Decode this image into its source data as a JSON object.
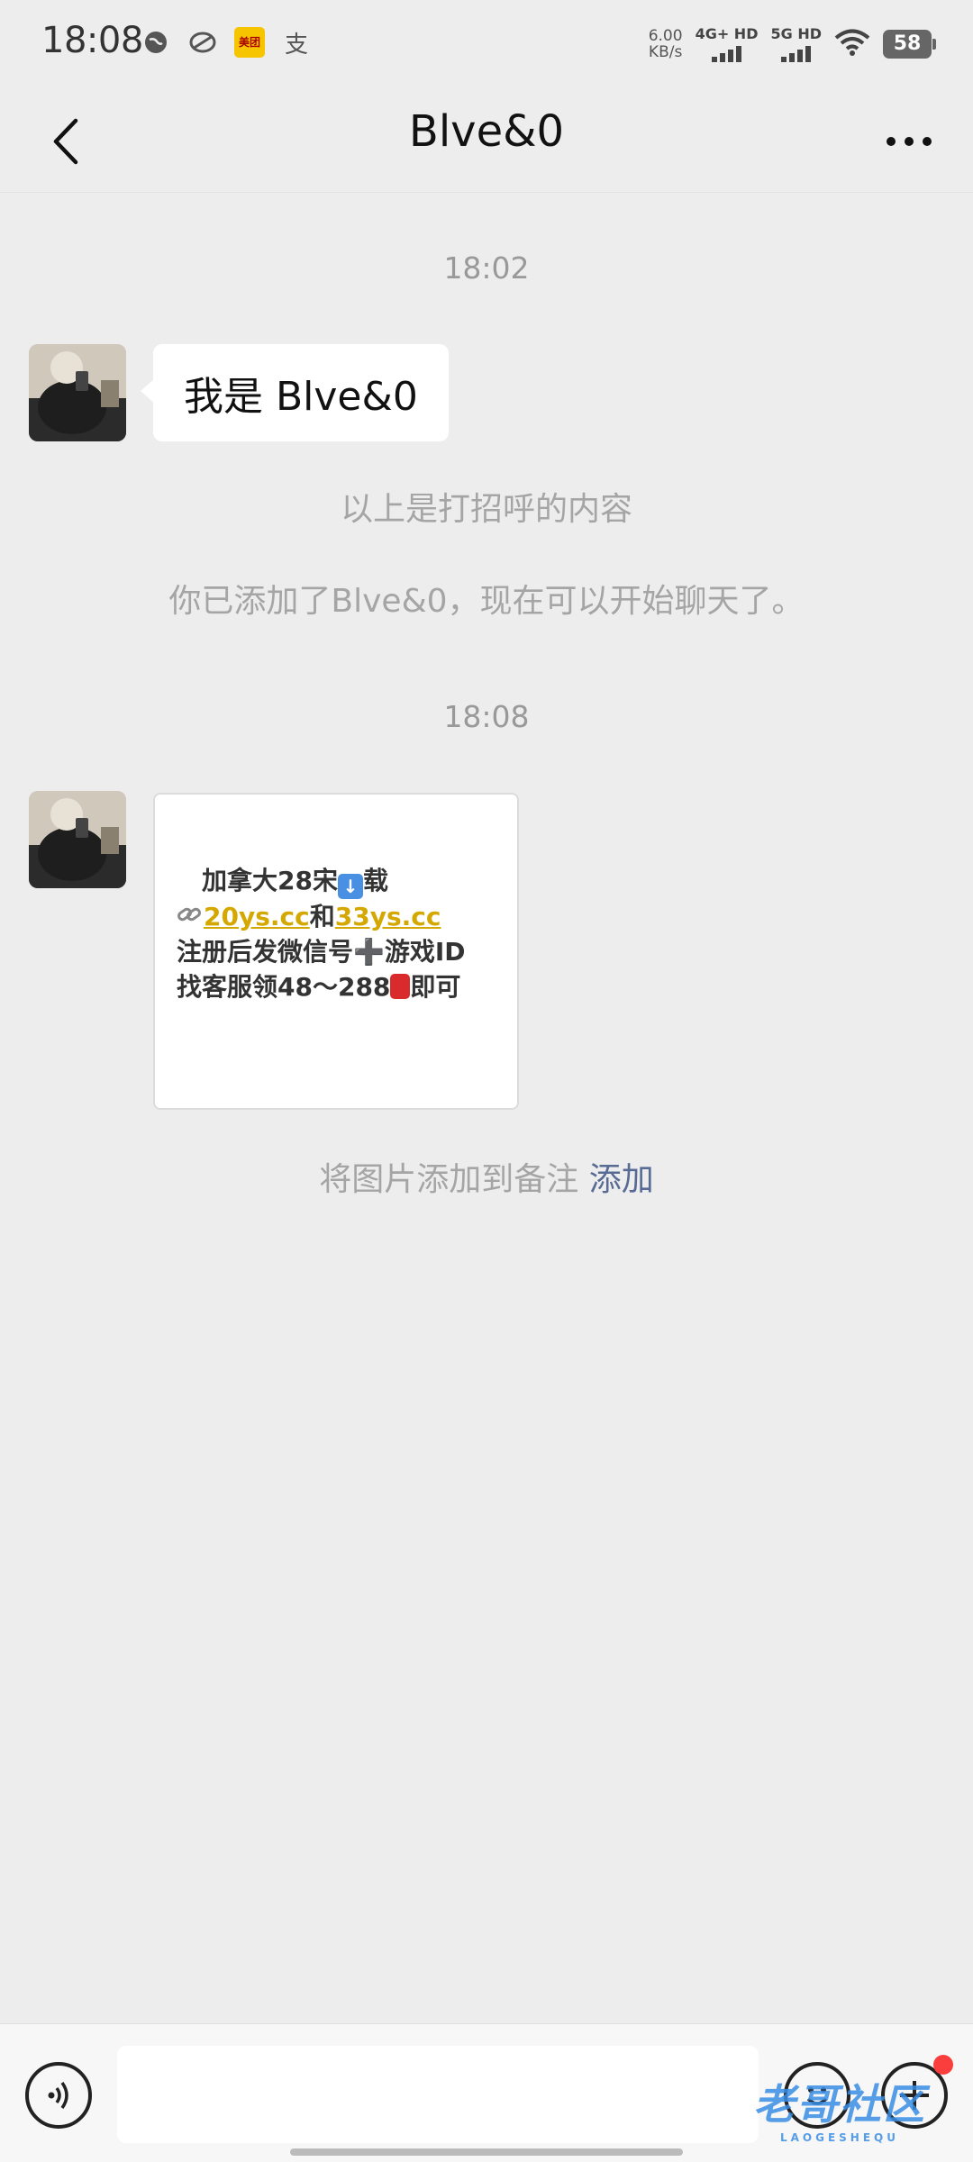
{
  "status_bar": {
    "time": "18:08",
    "meituan_label": "美团",
    "alipay_glyph": "支",
    "net_speed_value": "6.00",
    "net_speed_unit": "KB/s",
    "sim1_label": "4G+ HD",
    "sim2_label": "5G HD",
    "battery": "58"
  },
  "header": {
    "title": "Blve&0"
  },
  "chat": {
    "timestamp_1": "18:02",
    "message_1": "我是 Blve&0",
    "system_1": "以上是打招呼的内容",
    "system_2": "你已添加了Blve&0，现在可以开始聊天了。",
    "timestamp_2": "18:08",
    "image_message": {
      "line1": "加拿大28宋",
      "line1_end": "载",
      "line2_link1": "20ys.cc",
      "line2_mid": "和",
      "line2_link2": "33ys.cc",
      "line3": "注册后发微信号➕游戏ID",
      "line4_a": "找客服领48～288",
      "line4_b": "即可"
    },
    "remark_prompt": "将图片添加到备注",
    "remark_action": "添加"
  },
  "input_bar": {
    "text_value": ""
  },
  "watermark": {
    "text": "老哥社区",
    "subtext": "LAOGESHEQU"
  },
  "colors": {
    "background": "#ededed",
    "link": "#576b95",
    "highlight": "#d4a800"
  }
}
